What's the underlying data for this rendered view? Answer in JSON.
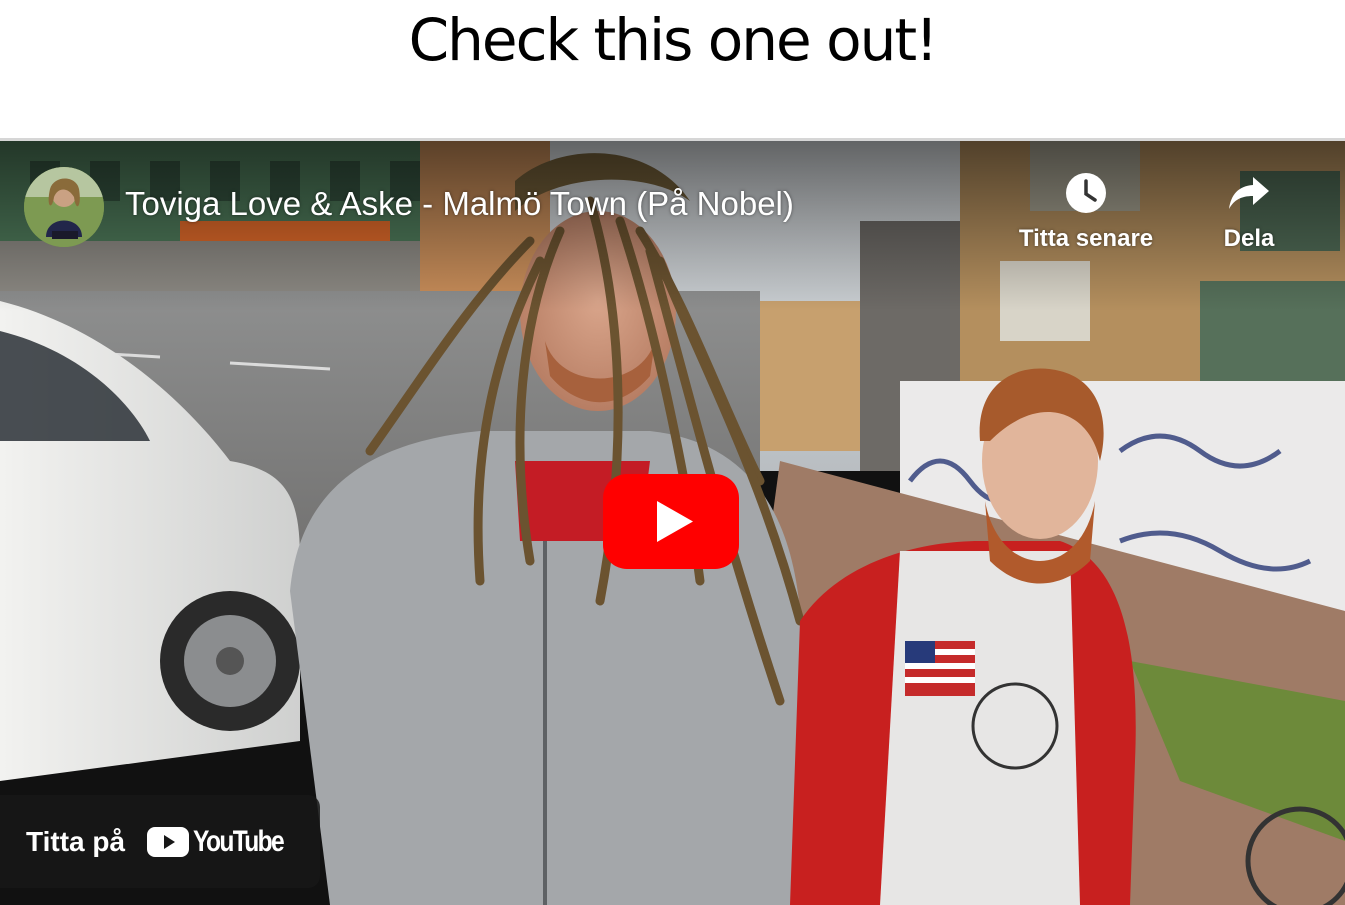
{
  "page": {
    "title": "Check this one out!"
  },
  "video": {
    "title": "Toviga Love & Aske - Malmö Town (På Nobel)",
    "channel_avatar": "channel-avatar",
    "actions": {
      "watch_later_label": "Titta senare",
      "watch_later_icon": "clock-icon",
      "share_label": "Dela",
      "share_icon": "share-arrow-icon"
    },
    "play_icon": "play-icon",
    "watch_on": {
      "label": "Titta på",
      "brand": "YouTube",
      "logo_icon": "youtube-logo-icon"
    }
  },
  "colors": {
    "youtube_red": "#ff0000",
    "overlay_dark": "#171717",
    "frame_border": "#d6d6d6"
  }
}
